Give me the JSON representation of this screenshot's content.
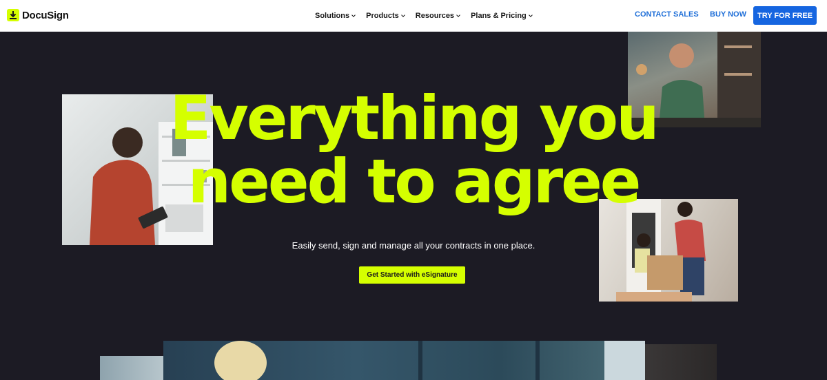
{
  "brand": {
    "name": "DocuSign",
    "accent": "#d5ff00",
    "link_color": "#1f6fd8",
    "primary_button": "#1565e0"
  },
  "nav": {
    "items": [
      {
        "label": "Solutions"
      },
      {
        "label": "Products"
      },
      {
        "label": "Resources"
      },
      {
        "label": "Plans & Pricing"
      }
    ]
  },
  "header_actions": {
    "contact_sales": "CONTACT SALES",
    "buy_now": "BUY NOW",
    "try_free": "TRY FOR FREE"
  },
  "hero": {
    "title_line1": "Everything you",
    "title_line2": "need to agree",
    "subtitle": "Easily send, sign and manage all your contracts in one place.",
    "cta": "Get Started with eSignature"
  }
}
